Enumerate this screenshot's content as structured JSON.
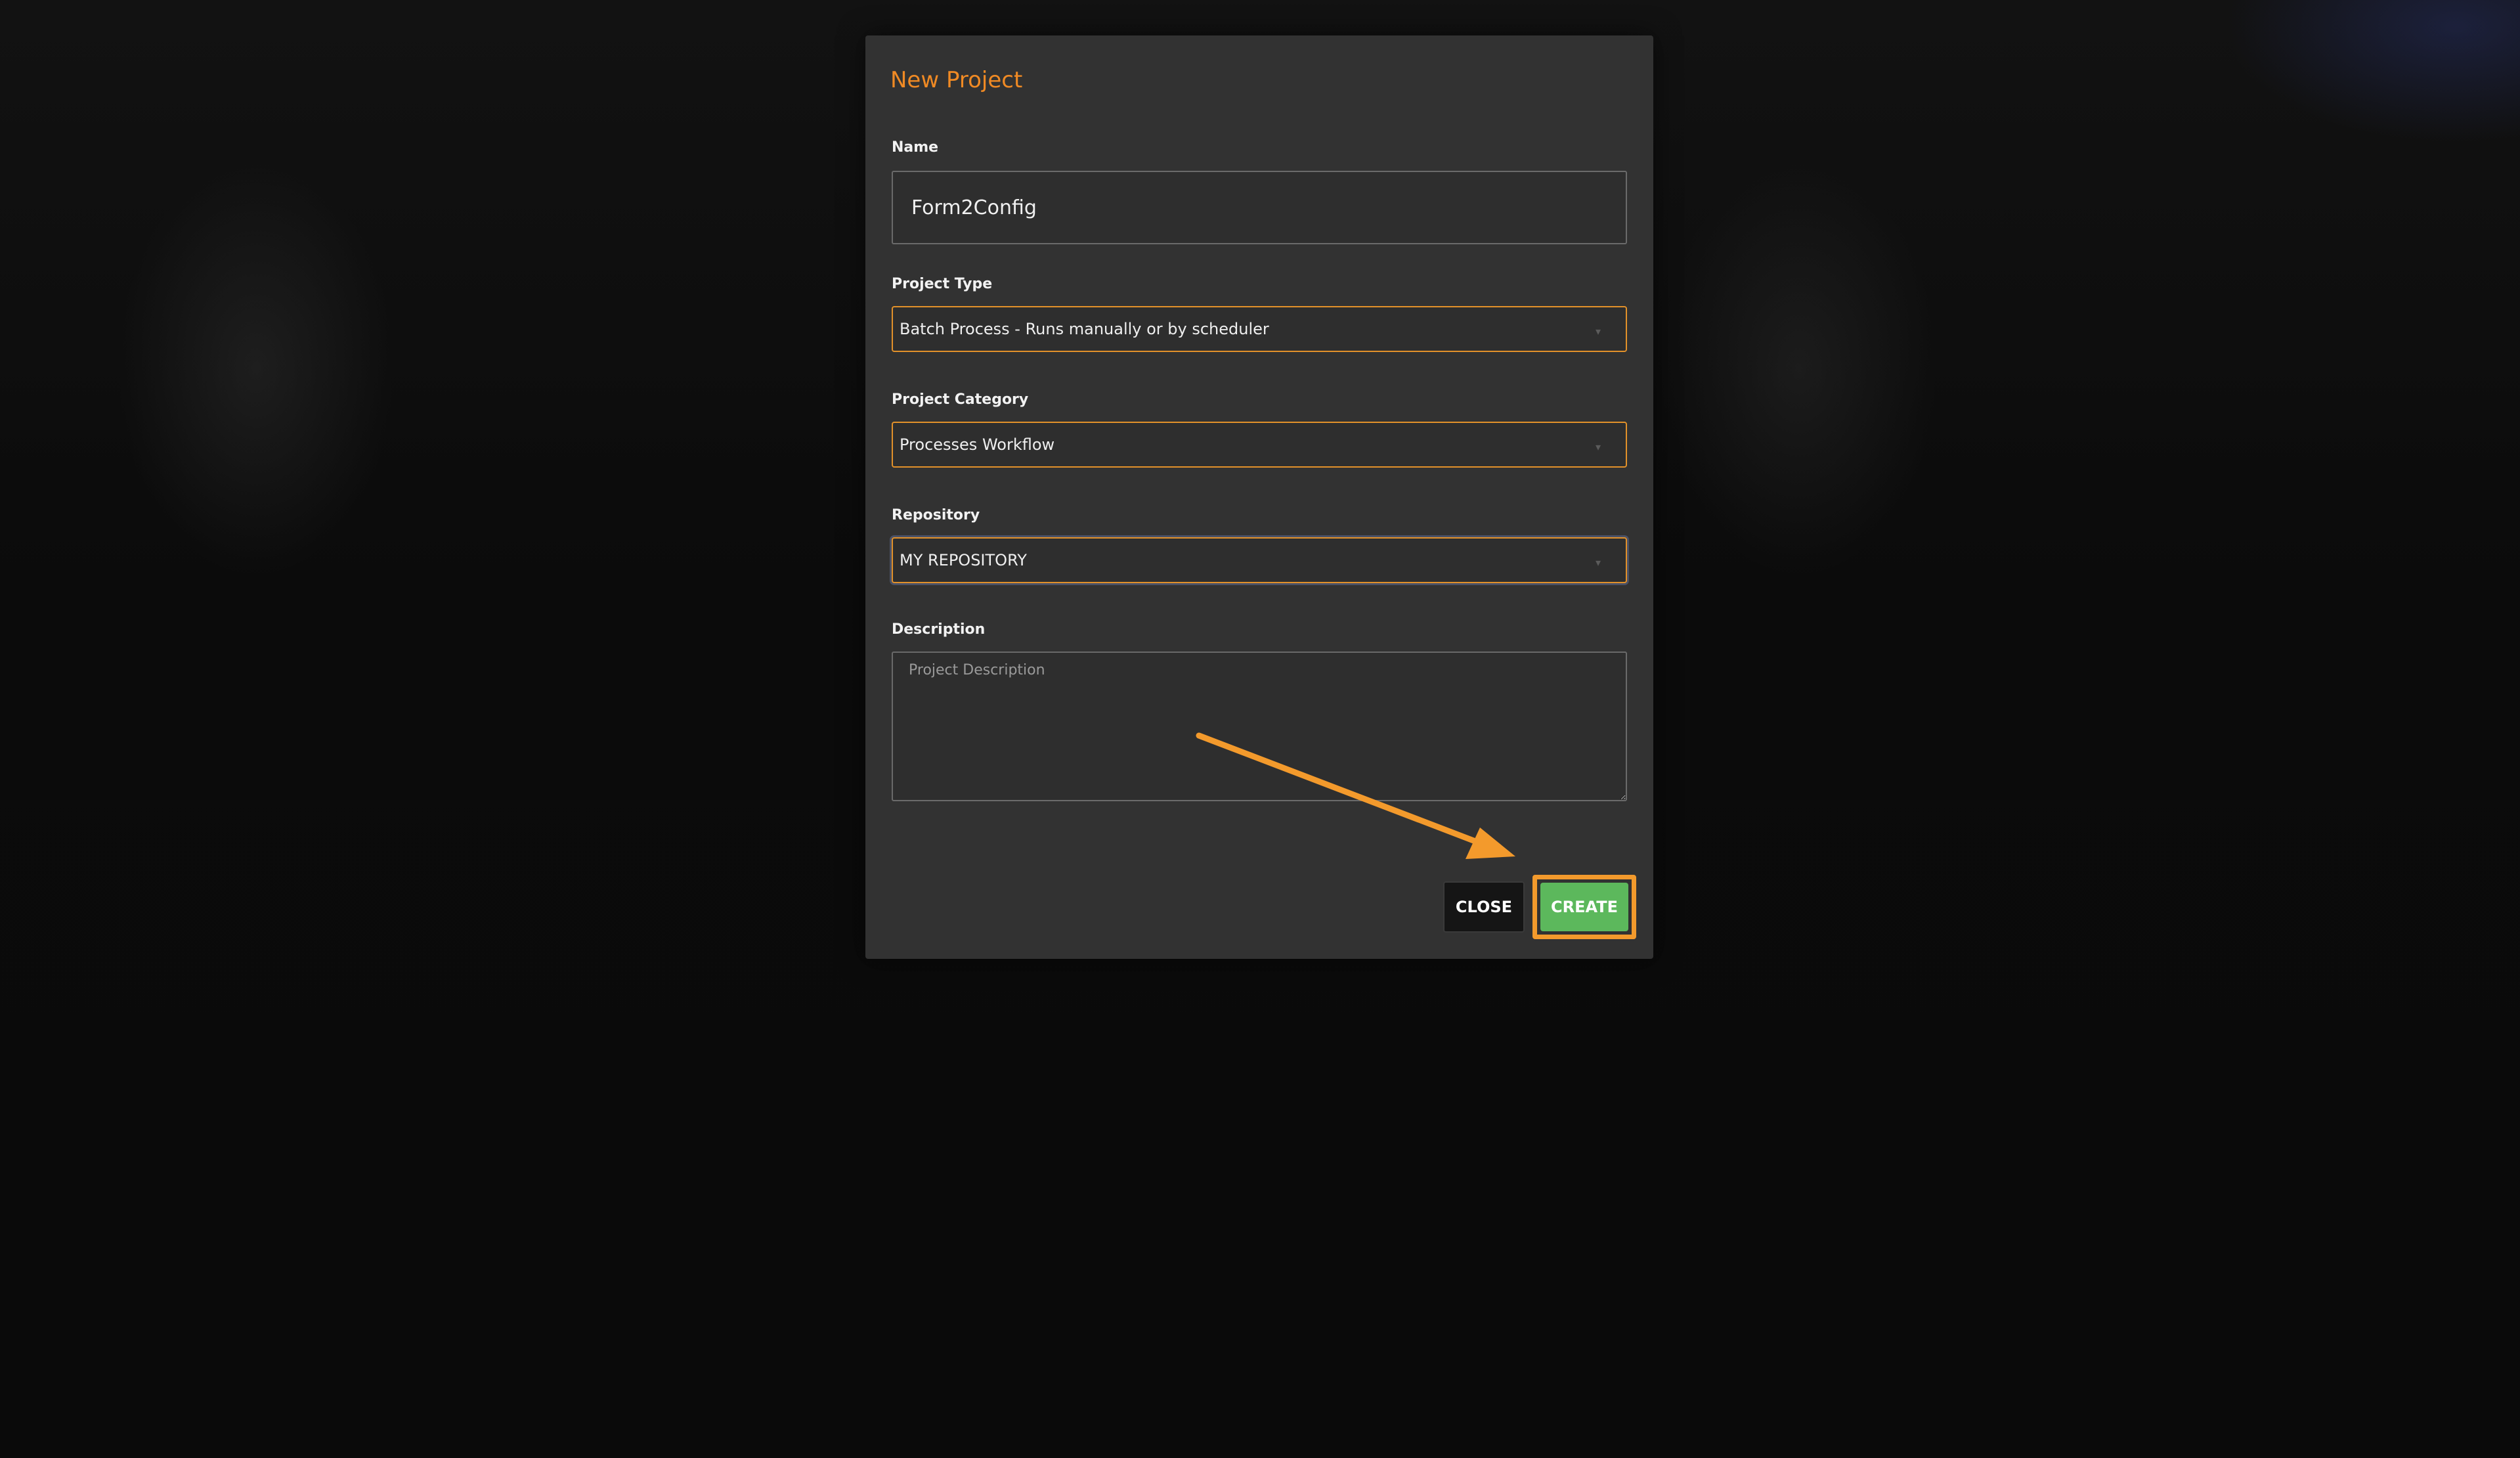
{
  "modal": {
    "title": "New Project",
    "name": {
      "label": "Name",
      "value": "Form2Config"
    },
    "project_type": {
      "label": "Project Type",
      "selected": "Batch Process - Runs manually or by scheduler"
    },
    "project_category": {
      "label": "Project Category",
      "selected": "Processes Workflow"
    },
    "repository": {
      "label": "Repository",
      "selected": "MY REPOSITORY"
    },
    "description": {
      "label": "Description",
      "placeholder": "Project Description",
      "value": ""
    },
    "buttons": {
      "close_label": "CLOSE",
      "create_label": "CREATE"
    }
  },
  "colors": {
    "accent": "#f08a24",
    "select_border": "#e2912a",
    "create_button": "#5cb85c",
    "close_button": "#151515",
    "modal_background": "#323232",
    "highlight": "#f39a2c"
  },
  "icons": {
    "dropdown": "chevron-down-icon",
    "annotation": "arrow-annotation"
  }
}
